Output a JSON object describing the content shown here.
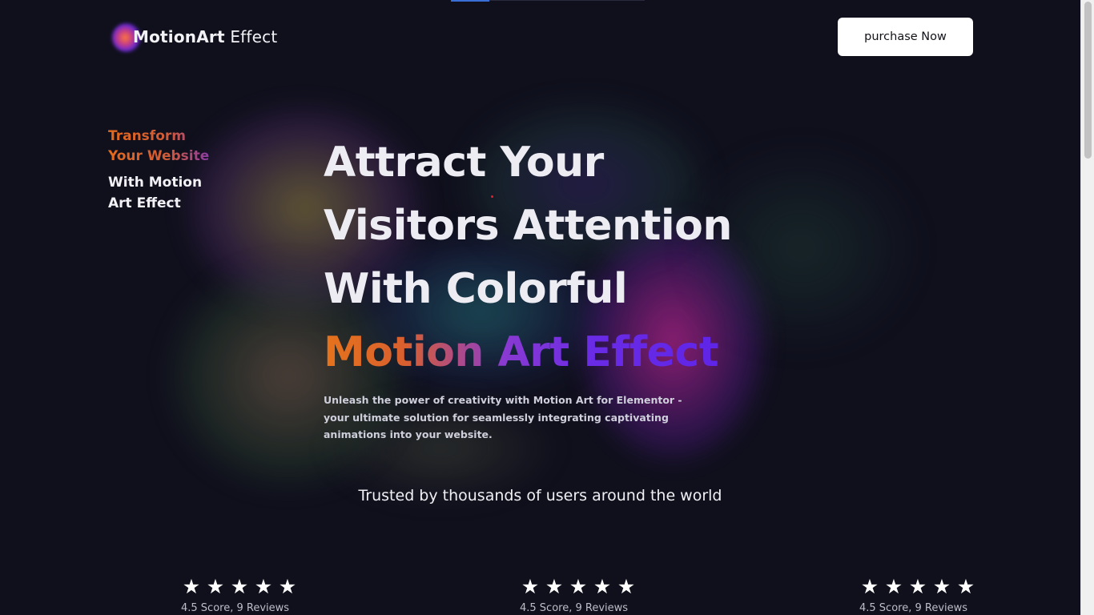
{
  "header": {
    "logo_bold": "MotionArt",
    "logo_light": "Effect",
    "purchase_label": "purchase Now"
  },
  "side_tagline": {
    "line1": "Transform",
    "line2": "Your Website",
    "line3": "With Motion",
    "line4": "Art Effect"
  },
  "hero": {
    "line1": "Attract Your",
    "line2": "Visitors Attention",
    "line3": "With Colorful",
    "line4": "Motion Art Effect",
    "description": "Unleash the power of creativity with Motion Art for Elementor - your ultimate solution for seamlessly integrating captivating animations into your website."
  },
  "trusted_text": "Trusted by thousands of users around the world",
  "ratings": [
    {
      "stars": 5,
      "text": "4.5 Score, 9 Reviews"
    },
    {
      "stars": 5,
      "text": "4.5 Score, 9 Reviews"
    },
    {
      "stars": 5,
      "text": "4.5 Score, 9 Reviews"
    }
  ],
  "colors": {
    "background": "#10101d",
    "gradient_orange": "#e6731c",
    "gradient_purple": "#5a22e8",
    "button_bg": "#ffffff"
  }
}
